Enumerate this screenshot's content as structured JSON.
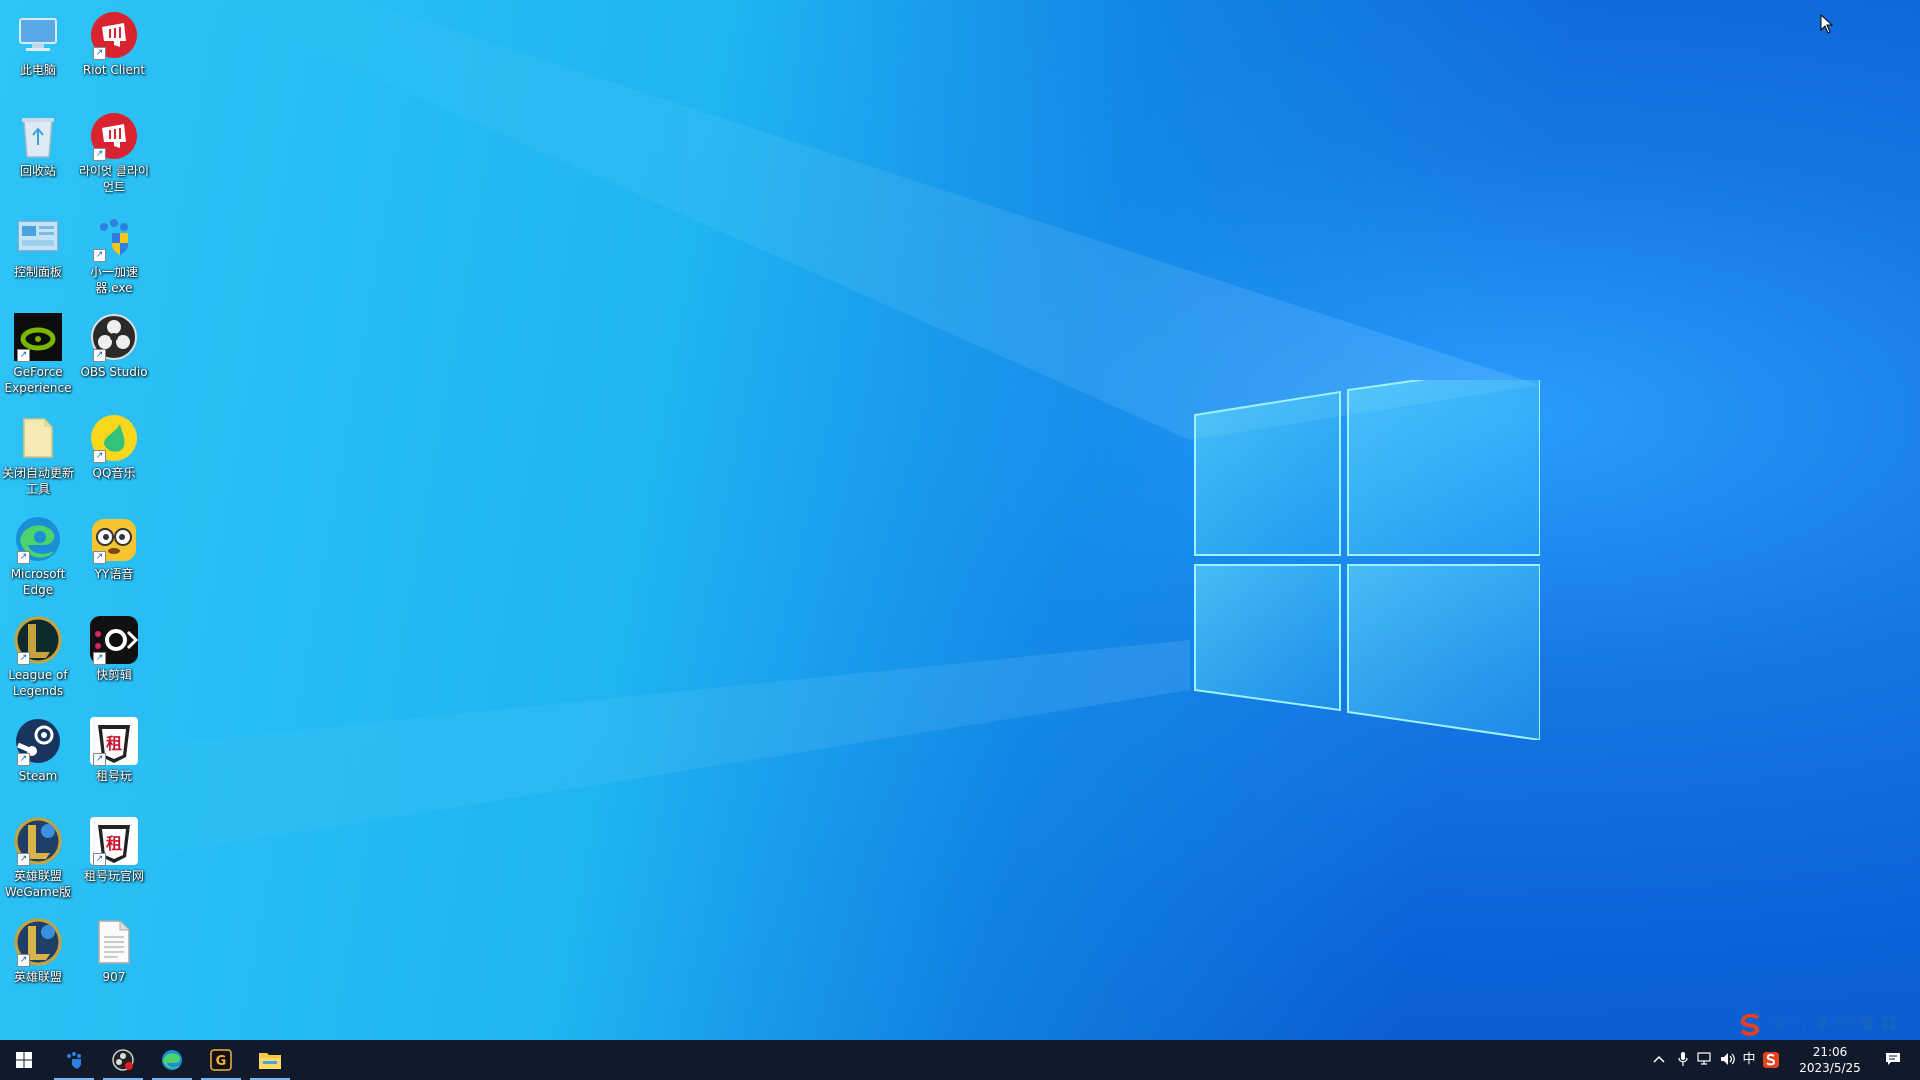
{
  "desktop": {
    "icons": [
      {
        "label": "此电脑",
        "icon": "computer-icon"
      },
      {
        "label": "Riot Client",
        "icon": "riot-client-icon"
      },
      {
        "label": "回收站",
        "icon": "recycle-bin-icon"
      },
      {
        "label": "라이엇 클라이언트",
        "icon": "riot-client-icon"
      },
      {
        "label": "控制面板",
        "icon": "control-panel-icon"
      },
      {
        "label": "小一加速器.exe",
        "icon": "accelerator-icon"
      },
      {
        "label": "GeForce Experience",
        "icon": "nvidia-icon"
      },
      {
        "label": "OBS Studio",
        "icon": "obs-icon"
      },
      {
        "label": "关闭自动更新工具",
        "icon": "folder-icon"
      },
      {
        "label": "QQ音乐",
        "icon": "qq-music-icon"
      },
      {
        "label": "Microsoft Edge",
        "icon": "edge-icon"
      },
      {
        "label": "YY语音",
        "icon": "yy-icon"
      },
      {
        "label": "League of Legends",
        "icon": "league-icon"
      },
      {
        "label": "快剪辑",
        "icon": "kuaijianji-icon"
      },
      {
        "label": "Steam",
        "icon": "steam-icon"
      },
      {
        "label": "租号玩",
        "icon": "zuhaowan-icon"
      },
      {
        "label": "英雄联盟WeGame版",
        "icon": "league-icon"
      },
      {
        "label": "租号玩官网",
        "icon": "zuhaowan-icon"
      },
      {
        "label": "英雄联盟",
        "icon": "league-icon"
      },
      {
        "label": "907",
        "icon": "text-file-icon"
      }
    ]
  },
  "ime": {
    "mode": "中",
    "punct": "°,"
  },
  "tray": {
    "lang": "中",
    "time": "21:06",
    "date": "2023/5/25"
  },
  "colors": {
    "taskbar": "#101a2b",
    "accent": "#1577e3"
  }
}
